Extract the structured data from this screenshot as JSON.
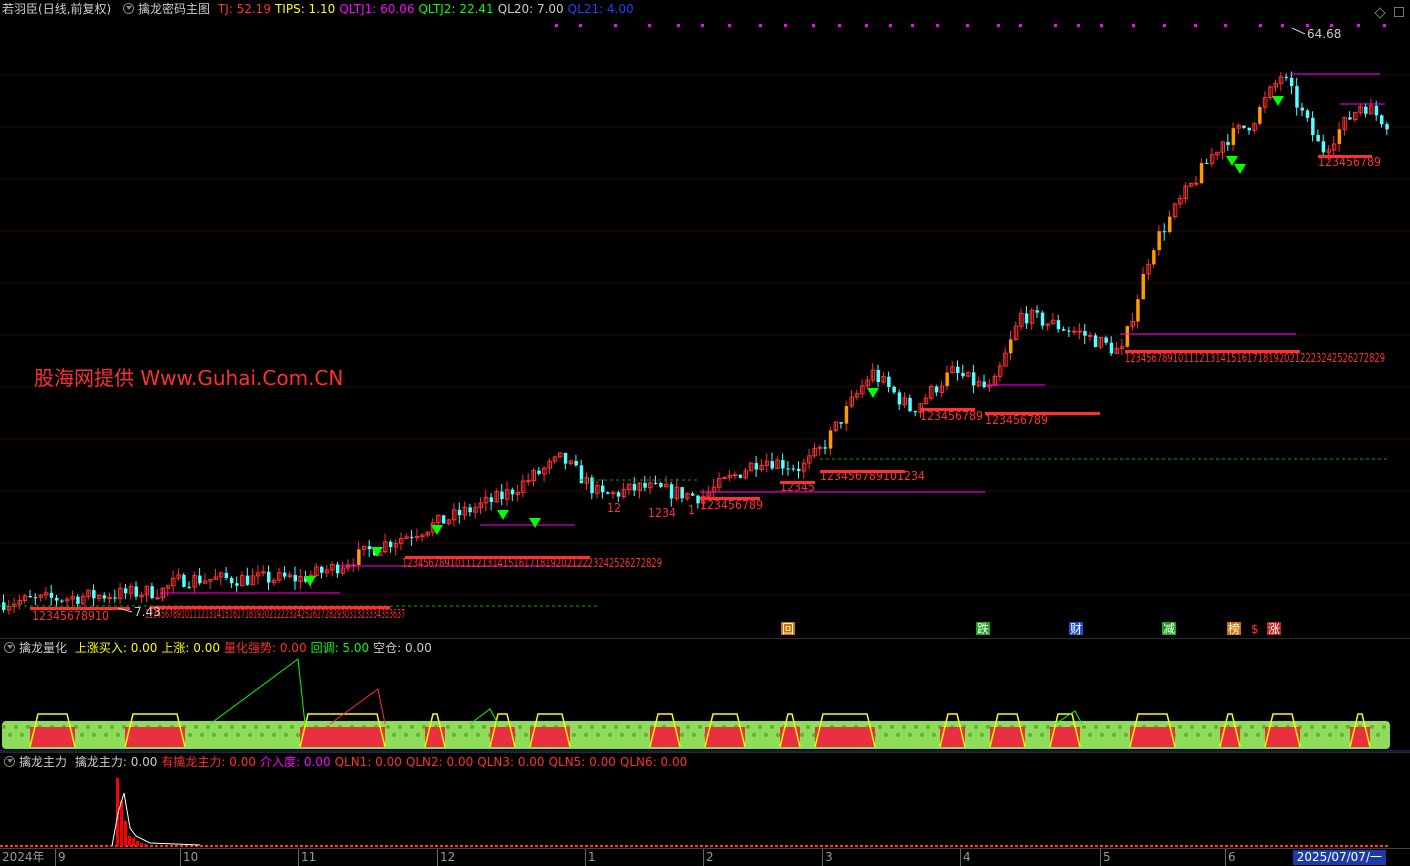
{
  "main": {
    "stock": "若羽臣",
    "period": "(日线,前复权)",
    "indicator": "擒龙密码主图",
    "fields": [
      {
        "label": "TJ: 52.19",
        "color": "#ff3030"
      },
      {
        "label": "TIPS: 1.10",
        "color": "#ffff00"
      },
      {
        "label": "QLTJ1: 60.06",
        "color": "#ff00ff"
      },
      {
        "label": "QLTJ2: 22.41",
        "color": "#00ff00"
      },
      {
        "label": "QL20: 7.00",
        "color": "#cccccc"
      },
      {
        "label": "QL21: 4.00",
        "color": "#2040ff"
      }
    ],
    "high_label": "64.68",
    "low_label": "7.43",
    "watermark": "股海网提供 Www.Guhai.Com.CN",
    "count_labels": [
      "12345678910",
      "12345678910111213141516171819202122232425262728293031323334353637",
      "1234567891011121314151617181920212223242526272829",
      "123456789",
      "1234",
      "1",
      "12",
      "123456789",
      "12345",
      "123456789101234",
      "123456789",
      "1234567891011121314151617181920212223242526272829",
      "123456789"
    ],
    "event_markers": [
      {
        "label": "回",
        "color": "#ffffff",
        "bg": "#d07000"
      },
      {
        "label": "跌",
        "color": "#ffffff",
        "bg": "#20a020"
      },
      {
        "label": "财",
        "color": "#ffffff",
        "bg": "#2050c0"
      },
      {
        "label": "减",
        "color": "#ffffff",
        "bg": "#20a020"
      },
      {
        "label": "榜",
        "color": "#ffffff",
        "bg": "#d07000"
      },
      {
        "label": "$",
        "color": "#ff3030",
        "bg": ""
      },
      {
        "label": "涨",
        "color": "#ffffff",
        "bg": "#c02020"
      }
    ]
  },
  "ind1": {
    "name": "擒龙量化",
    "fields": [
      {
        "label": "上涨买入: 0.00",
        "color": "#ffff00"
      },
      {
        "label": "上涨: 0.00",
        "color": "#ffff00"
      },
      {
        "label": "量化强势: 0.00",
        "color": "#ff3030"
      },
      {
        "label": "回调: 5.00",
        "color": "#00ff00"
      },
      {
        "label": "空仓: 0.00",
        "color": "#cccccc"
      }
    ]
  },
  "ind2": {
    "name": "擒龙主力",
    "fields": [
      {
        "label": "擒龙主力: 0.00",
        "color": "#cccccc"
      },
      {
        "label": "有擒龙主力: 0.00",
        "color": "#ff3030"
      },
      {
        "label": "介入度: 0.00",
        "color": "#ff00ff"
      },
      {
        "label": "QLN1: 0.00",
        "color": "#ff3030"
      },
      {
        "label": "QLN2: 0.00",
        "color": "#ff3030"
      },
      {
        "label": "QLN3: 0.00",
        "color": "#ff3030"
      },
      {
        "label": "QLN5: 0.00",
        "color": "#ff3030"
      },
      {
        "label": "QLN6: 0.00",
        "color": "#ff3030"
      }
    ]
  },
  "time_axis": {
    "labels": [
      "2024年",
      "9",
      "10",
      "11",
      "12",
      "1",
      "2",
      "3",
      "4",
      "5",
      "6"
    ],
    "cursor_date": "2025/07/07/一"
  },
  "colors": {
    "up": "#ff3030",
    "down": "#54ffff",
    "breakout": "#ff9900",
    "signal": "#00ff00",
    "support": "#ff00ff",
    "count_text": "#ff3030"
  }
}
